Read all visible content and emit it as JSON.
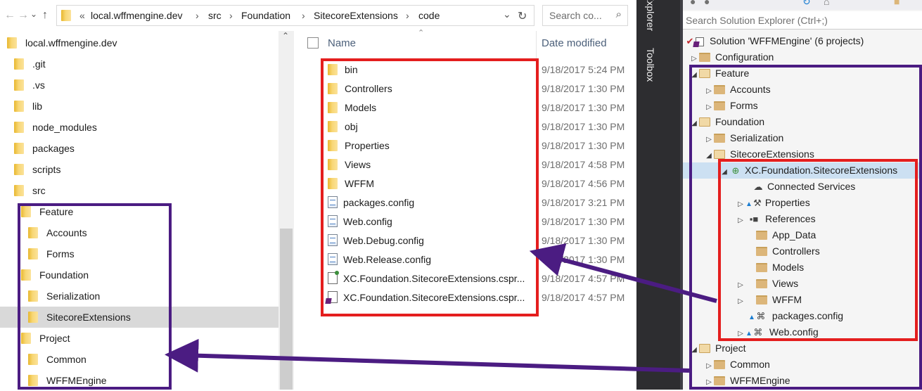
{
  "address_bar": {
    "back_glyph": "←",
    "forward_glyph": "→",
    "recent_glyph": "⌄",
    "up_glyph": "↑",
    "overflow": "«",
    "crumbs": [
      "local.wffmengine.dev",
      "src",
      "Foundation",
      "SitecoreExtensions",
      "code"
    ],
    "separator": "›",
    "dropdown_glyph": "⌄",
    "refresh_glyph": "↻",
    "search_placeholder": "Search co...",
    "search_glyph": "⌕"
  },
  "nav_tree": {
    "scroll_up_glyph": "⌃",
    "items": [
      {
        "label": "local.wffmengine.dev"
      },
      {
        "label": ".git"
      },
      {
        "label": ".vs"
      },
      {
        "label": "lib"
      },
      {
        "label": "node_modules"
      },
      {
        "label": "packages"
      },
      {
        "label": "scripts"
      },
      {
        "label": "src"
      },
      {
        "label": "Feature"
      },
      {
        "label": "Accounts"
      },
      {
        "label": "Forms"
      },
      {
        "label": "Foundation"
      },
      {
        "label": "Serialization"
      },
      {
        "label": "SitecoreExtensions",
        "selected": true
      },
      {
        "label": "Project"
      },
      {
        "label": "Common"
      },
      {
        "label": "WFFMEngine"
      }
    ]
  },
  "file_list": {
    "sort_glyph": "⌃",
    "columns": {
      "name": "Name",
      "date": "Date modified"
    },
    "rows": [
      {
        "name": "bin",
        "date": "9/18/2017 5:24 PM",
        "icon": "folder-icon"
      },
      {
        "name": "Controllers",
        "date": "9/18/2017 1:30 PM",
        "icon": "folder-icon"
      },
      {
        "name": "Models",
        "date": "9/18/2017 1:30 PM",
        "icon": "folder-icon"
      },
      {
        "name": "obj",
        "date": "9/18/2017 1:30 PM",
        "icon": "folder-icon"
      },
      {
        "name": "Properties",
        "date": "9/18/2017 1:30 PM",
        "icon": "folder-icon"
      },
      {
        "name": "Views",
        "date": "9/18/2017 4:58 PM",
        "icon": "folder-icon"
      },
      {
        "name": "WFFM",
        "date": "9/18/2017 4:56 PM",
        "icon": "folder-icon"
      },
      {
        "name": "packages.config",
        "date": "9/18/2017 3:21 PM",
        "icon": "config-file-icon"
      },
      {
        "name": "Web.config",
        "date": "9/18/2017 1:30 PM",
        "icon": "config-file-icon"
      },
      {
        "name": "Web.Debug.config",
        "date": "9/18/2017 1:30 PM",
        "icon": "config-file-icon"
      },
      {
        "name": "Web.Release.config",
        "date": "9/18/2017 1:30 PM",
        "icon": "config-file-icon"
      },
      {
        "name": "XC.Foundation.SitecoreExtensions.cspr...",
        "date": "9/18/2017 4:57 PM",
        "icon": "project-user-file-icon"
      },
      {
        "name": "XC.Foundation.SitecoreExtensions.cspr...",
        "date": "9/18/2017 4:57 PM",
        "icon": "csharp-project-file-icon"
      }
    ]
  },
  "side_tabs": [
    "Explorer",
    "Toolbox"
  ],
  "solution_explorer": {
    "search_placeholder": "Search Solution Explorer (Ctrl+;)",
    "toolbar_glyphs": [
      "●",
      "●",
      "↻",
      "⌂",
      "■"
    ],
    "expanded_glyph": "◢",
    "collapsed_glyph": "▷",
    "items": [
      {
        "label": "Solution 'WFFMEngine' (6 projects)",
        "icon": "solution-icon",
        "glyph": "✔"
      },
      {
        "label": "Configuration",
        "icon": "folder-icon",
        "expander": "collapsed"
      },
      {
        "label": "Feature",
        "icon": "folder-open-icon",
        "expander": "expanded"
      },
      {
        "label": "Accounts",
        "icon": "folder-icon",
        "expander": "collapsed"
      },
      {
        "label": "Forms",
        "icon": "folder-icon",
        "expander": "collapsed"
      },
      {
        "label": "Foundation",
        "icon": "folder-open-icon",
        "expander": "expanded"
      },
      {
        "label": "Serialization",
        "icon": "folder-icon",
        "expander": "collapsed"
      },
      {
        "label": "SitecoreExtensions",
        "icon": "folder-open-icon",
        "expander": "expanded"
      },
      {
        "label": "XC.Foundation.SitecoreExtensions",
        "icon": "web-project-icon",
        "glyph": "⊕",
        "expander": "expanded",
        "highlighted": true
      },
      {
        "label": "Connected Services",
        "icon": "cloud-icon",
        "glyph": "☁"
      },
      {
        "label": "Properties",
        "icon": "wrench-icon",
        "glyph": "⚒",
        "expander": "collapsed",
        "lock": "▲"
      },
      {
        "label": "References",
        "icon": "references-icon",
        "glyph": "▪■",
        "expander": "collapsed"
      },
      {
        "label": "App_Data",
        "icon": "folder-icon"
      },
      {
        "label": "Controllers",
        "icon": "folder-icon"
      },
      {
        "label": "Models",
        "icon": "folder-icon"
      },
      {
        "label": "Views",
        "icon": "folder-icon",
        "expander": "collapsed"
      },
      {
        "label": "WFFM",
        "icon": "folder-icon",
        "expander": "collapsed"
      },
      {
        "label": "packages.config",
        "icon": "config-file-icon",
        "glyph": "⌘",
        "lock": "▲"
      },
      {
        "label": "Web.config",
        "icon": "config-file-icon",
        "glyph": "⌘",
        "expander": "collapsed",
        "lock": "▲"
      },
      {
        "label": "Project",
        "icon": "folder-open-icon",
        "expander": "expanded"
      },
      {
        "label": "Common",
        "icon": "folder-icon",
        "expander": "collapsed"
      },
      {
        "label": "WFFMEngine",
        "icon": "folder-icon",
        "expander": "collapsed"
      }
    ]
  },
  "annotation_colors": {
    "red": "#e41e1e",
    "purple": "#4b1c82"
  }
}
